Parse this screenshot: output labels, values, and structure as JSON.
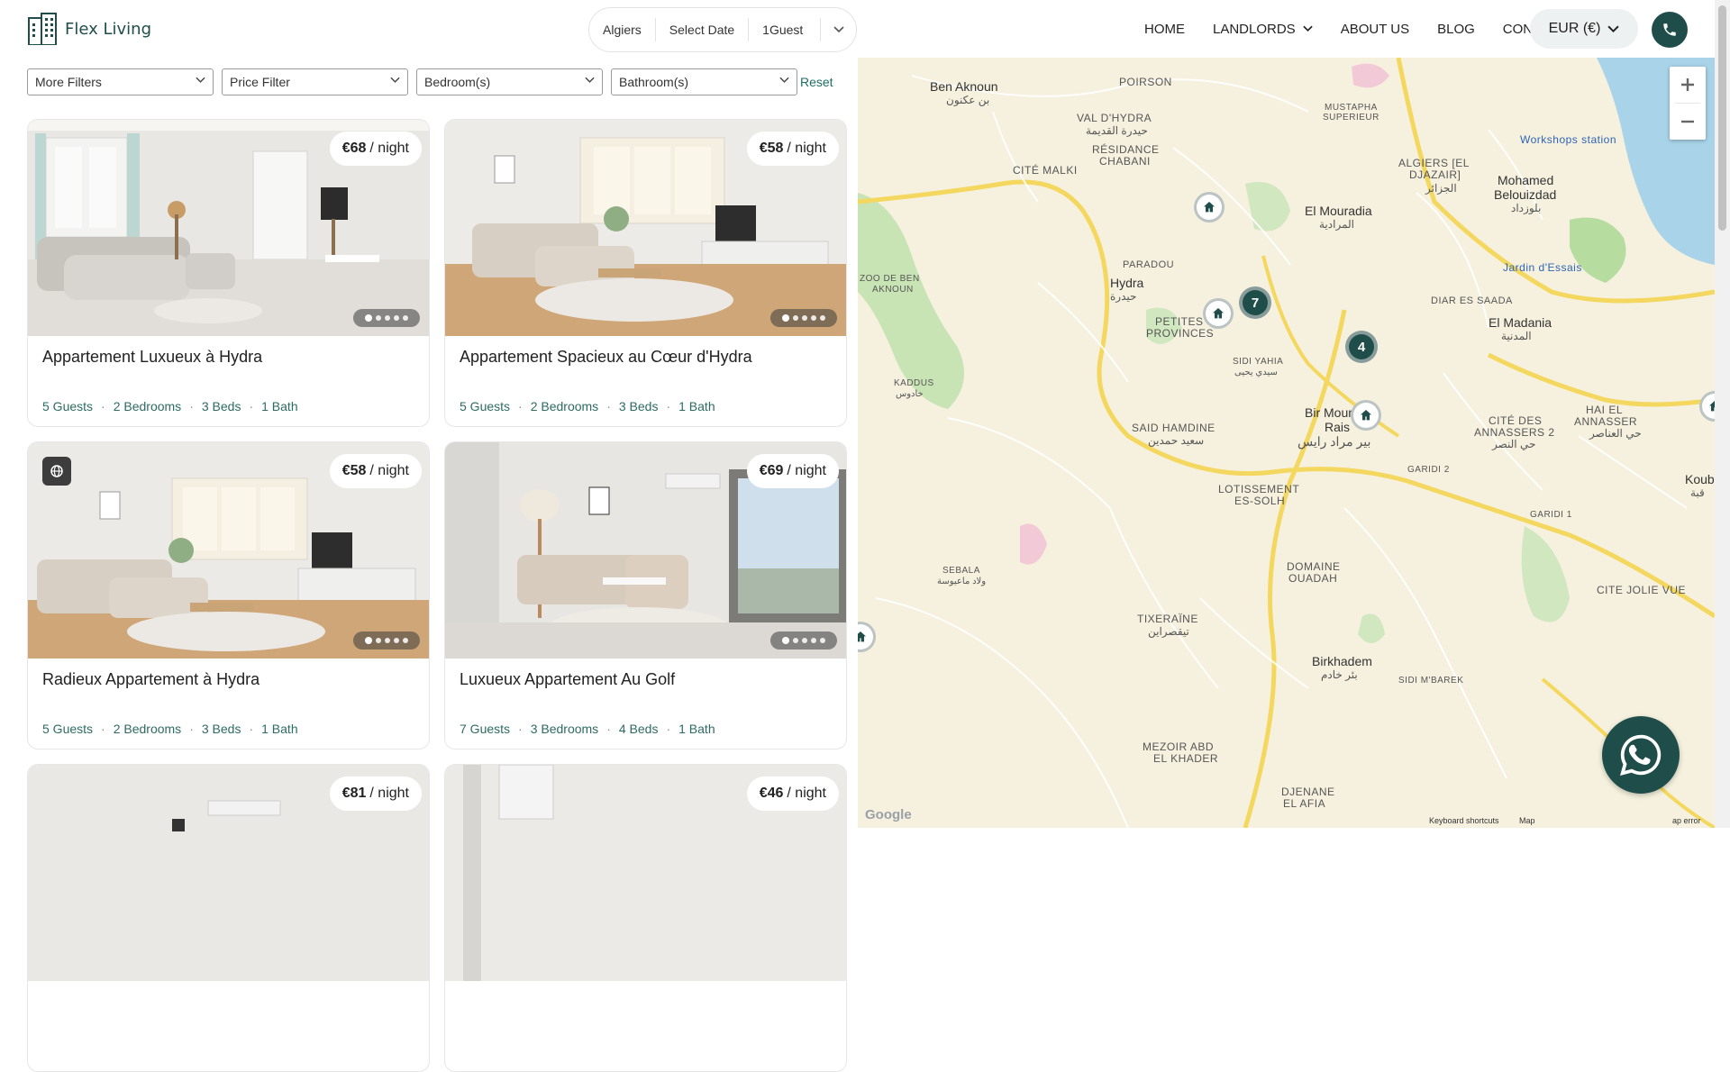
{
  "brand": {
    "name": "Flex Living",
    "color": "#1f4e4a"
  },
  "search": {
    "location": "Algiers",
    "date": "Select Date",
    "guests": "1Guest"
  },
  "nav": {
    "home": "HOME",
    "landlords": "LANDLORDS",
    "about": "ABOUT US",
    "blog": "BLOG",
    "contact": "CONTACT"
  },
  "currency": "EUR (€)",
  "filters": {
    "more": "More Filters",
    "price": "Price Filter",
    "bedrooms": "Bedroom(s)",
    "bathrooms": "Bathroom(s)",
    "reset": "Reset"
  },
  "listings": [
    {
      "title": "Appartement Luxueux à Hydra",
      "price": "€68",
      "unit": "/ night",
      "guests": "5 Guests",
      "bedrooms": "2 Bedrooms",
      "beds": "3 Beds",
      "baths": "1 Bath"
    },
    {
      "title": "Appartement Spacieux au Cœur d'Hydra",
      "price": "€58",
      "unit": "/ night",
      "guests": "5 Guests",
      "bedrooms": "2 Bedrooms",
      "beds": "3 Beds",
      "baths": "1 Bath"
    },
    {
      "title": "Radieux Appartement à Hydra",
      "price": "€58",
      "unit": "/ night",
      "guests": "5 Guests",
      "bedrooms": "2 Bedrooms",
      "beds": "3 Beds",
      "baths": "1 Bath"
    },
    {
      "title": "Luxueux Appartement Au Golf",
      "price": "€69",
      "unit": "/ night",
      "guests": "7 Guests",
      "bedrooms": "3 Bedrooms",
      "beds": "4 Beds",
      "baths": "1 Bath"
    },
    {
      "title": "",
      "price": "€81",
      "unit": "/ night"
    },
    {
      "title": "",
      "price": "€46",
      "unit": "/ night"
    }
  ],
  "map": {
    "clusters": [
      "7",
      "4"
    ],
    "labels": {
      "ben_aknoun": "Ben Aknoun",
      "ben_aknoun_ar": "بن عكنون",
      "poirson": "POIRSON",
      "val_dhydra": "VAL D'HYDRA",
      "val_dhydra_ar": "حيدرة القديمة",
      "residence": "RÉSIDANCE",
      "chabani": "CHABANI",
      "cite_malki": "CITÉ MALKI",
      "mustapha": "MUSTAPHA",
      "superieur": "SUPERIEUR",
      "algiers": "ALGIERS [EL",
      "djazair": "DJAZAIR]",
      "djazair_ar": "الجزائر",
      "workshops": "Workshops station",
      "mohamed": "Mohamed",
      "belouizdad": "Belouizdad",
      "belouizdad_ar": "بلوزداد",
      "el_mouradia": "El Mouradia",
      "el_mouradia_ar": "المرادية",
      "paradou": "PARADOU",
      "hydra": "Hydra",
      "hydra_ar": "حيدرة",
      "zoo": "ZOO DE BEN",
      "aknoun": "AKNOUN",
      "petites": "PETITES",
      "provinces": "PROVINCES",
      "jardin": "Jardin d'Essais",
      "diar": "DIAR ES SAADA",
      "el_madania": "El Madania",
      "el_madania_ar": "المدنية",
      "sidi_yahia": "SIDI YAHIA",
      "sidi_yahia_ar": "سيدي يحيى",
      "kaddous": "KADDUS",
      "kaddous_ar": "خادوس",
      "bir_mourad": "Bir Mourad",
      "rais": "Rais",
      "bir_mourad_ar": "بير مراد رايس",
      "said": "SAID HAMDINE",
      "said_ar": "سعيد حمدين",
      "hai_el": "HAI EL",
      "annasser": "ANNASSER",
      "annasser_ar": "حي العناصر",
      "cite_des": "CITÉ DES",
      "annassers2": "ANNASSERS 2",
      "annassers_ar": "حي النصر",
      "garidi2": "GARIDI 2",
      "garidi1": "GARIDI 1",
      "lotissement": "LOTISSEMENT",
      "es_solh": "ES-SOLH",
      "domaine": "DOMAINE",
      "ouadah": "OUADAH",
      "sebala": "SEBALA",
      "sebala_ar": "ولاد ماعيوسة",
      "tixeraine": "TIXERAÏNE",
      "tixeraine_ar": "تيقصراين",
      "cite_jolie": "CITE JOLIE VUE",
      "birkhadem": "Birkhadem",
      "birkhadem_ar": "بئر خادم",
      "sidi_mbarek": "SIDI M'BAREK",
      "mezoir": "MEZOIR ABD",
      "el_khader": "EL KHADER",
      "djenane": "DJENANE",
      "el_afia": "EL AFIA",
      "koub": "Koub",
      "koub_ar": "قبة",
      "google": "Google",
      "keyboard": "Keyboard shortcuts",
      "mapdata": "Map",
      "error": "ap error"
    }
  }
}
